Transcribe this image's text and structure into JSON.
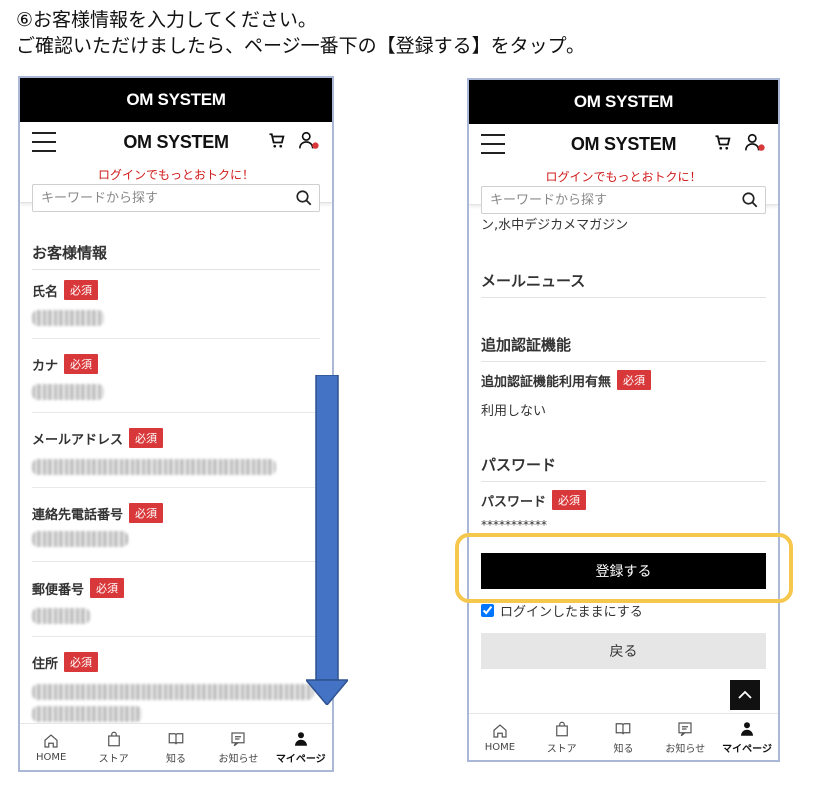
{
  "instructions": {
    "line1": "⑥お客様情報を入力してください。",
    "line2": "ご確認いただけましたら、ページ一番下の【登録する】をタップ。"
  },
  "brand": "OM SYSTEM",
  "header": {
    "logo": "OM SYSTEM",
    "login_prompt": "ログインでもっとおトクに！",
    "search_placeholder": "キーワードから探す"
  },
  "left": {
    "section_title": "お客様情報",
    "required_badge": "必須",
    "fields": [
      {
        "label": "氏名"
      },
      {
        "label": "カナ"
      },
      {
        "label": "メールアドレス"
      },
      {
        "label": "連絡先電話番号"
      },
      {
        "label": "郵便番号"
      },
      {
        "label": "住所"
      }
    ]
  },
  "right": {
    "partial_text": "ン,水中デジカメマガジン",
    "mail_news_title": "メールニュース",
    "auth_title": "追加認証機能",
    "auth_field_label": "追加認証機能利用有無",
    "auth_value": "利用しない",
    "password_title": "パスワード",
    "password_field_label": "パスワード",
    "password_value": "***********",
    "register_button": "登録する",
    "keep_login_label": "ログインしたままにする",
    "back_button": "戻る",
    "required_badge": "必須"
  },
  "tabs": [
    {
      "label": "HOME",
      "icon": "home-icon"
    },
    {
      "label": "ストア",
      "icon": "bag-icon"
    },
    {
      "label": "知る",
      "icon": "book-icon"
    },
    {
      "label": "お知らせ",
      "icon": "notice-icon"
    },
    {
      "label": "マイページ",
      "icon": "person-icon"
    }
  ],
  "colors": {
    "required": "#d9383a",
    "login_link": "#d11b1b",
    "highlight": "#f6c74d",
    "arrow": "#4472c4"
  }
}
